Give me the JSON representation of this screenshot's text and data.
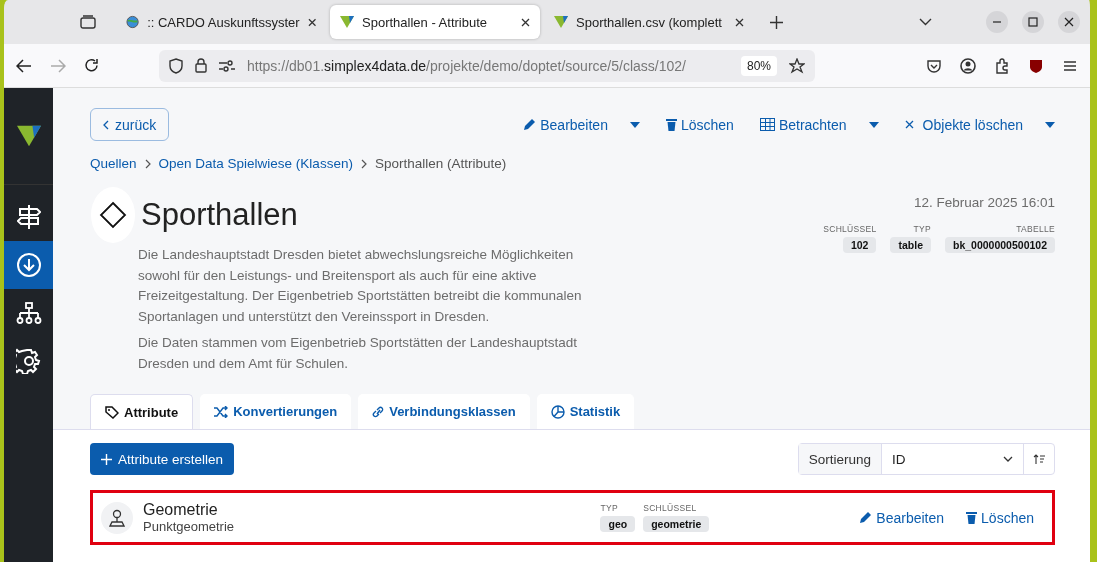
{
  "browser": {
    "tabs": [
      {
        "title": ":: CARDO Auskunftssyster",
        "selected": false
      },
      {
        "title": "Sporthallen - Attribute",
        "selected": true
      },
      {
        "title": "Sporthallen.csv (komplett",
        "selected": false
      }
    ],
    "url": {
      "prefix": "https://db01.",
      "domain": "simplex4data.de",
      "path": "/projekte/demo/doptet/source/5/class/102/"
    },
    "zoom": "80%"
  },
  "sidebar": {
    "items": [
      {
        "selected": false
      },
      {
        "selected": true
      },
      {
        "selected": false
      },
      {
        "selected": false
      }
    ]
  },
  "back_button": "zurück",
  "actions": [
    {
      "label": "Bearbeiten",
      "dropdown": true
    },
    {
      "label": "Löschen",
      "dropdown": false
    },
    {
      "label": "Betrachten",
      "dropdown": true
    },
    {
      "label": "Objekte löschen",
      "dropdown": true
    }
  ],
  "breadcrumb": [
    {
      "label": "Quellen",
      "link": true
    },
    {
      "label": "Open Data Spielwiese (Klassen)",
      "link": true
    },
    {
      "label": "Sporthallen (Attribute)",
      "link": false
    }
  ],
  "title": "Sporthallen",
  "date": "12. Februar 2025 16:01",
  "meta": [
    {
      "label": "SCHLÜSSEL",
      "value": "102"
    },
    {
      "label": "TYP",
      "value": "table"
    },
    {
      "label": "TABELLE",
      "value": "bk_0000000500102"
    }
  ],
  "description": [
    "Die Landeshauptstadt Dresden bietet abwechslungsreiche Möglichkeiten sowohl für den Leistungs- und Breitensport als auch für eine aktive Freizeitgestaltung. Der Eigenbetrieb Sportstätten betreibt die kommunalen Sportanlagen und unterstützt den Vereinssport in Dresden.",
    "Die Daten stammen vom Eigenbetrieb Sportstätten der Landeshauptstadt Dresden und dem Amt für Schulen."
  ],
  "tabs": [
    {
      "label": "Attribute",
      "selected": true
    },
    {
      "label": "Konvertierungen",
      "selected": false
    },
    {
      "label": "Verbindungsklassen",
      "selected": false
    },
    {
      "label": "Statistik",
      "selected": false
    }
  ],
  "create_button": "Attribute erstellen",
  "sort": {
    "label": "Sortierung",
    "value": "ID"
  },
  "attributes": [
    {
      "name": "Geometrie",
      "type_label": "Punktgeometrie",
      "highlighted": true,
      "meta": [
        {
          "label": "TYP",
          "value": "geo"
        },
        {
          "label": "SCHLÜSSEL",
          "value": "geometrie"
        }
      ],
      "actions": [
        "Bearbeiten",
        "Löschen"
      ]
    }
  ]
}
